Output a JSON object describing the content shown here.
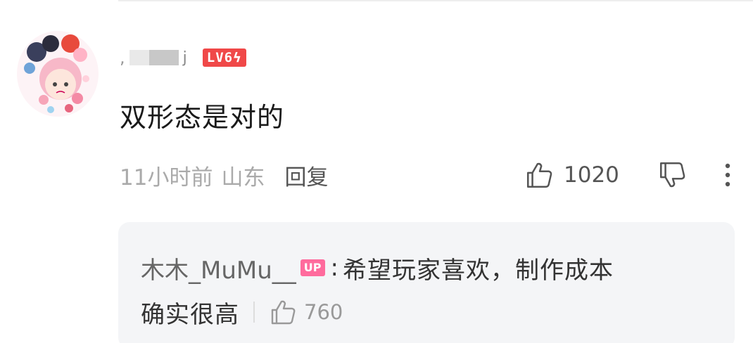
{
  "comment": {
    "username_prefix": ",",
    "username_suffix": "j",
    "level": "LV6",
    "level_icon": "lightning-icon",
    "text": "双形态是对的",
    "time": "11小时前",
    "location": "山东",
    "reply_label": "回复",
    "like_count": "1020"
  },
  "reply": {
    "author": "木木_MuMu__",
    "badge": "UP",
    "colon": ":",
    "content_line1": "希望玩家喜欢，制作成本",
    "content_line2": "确实很高",
    "like_count": "760"
  },
  "colors": {
    "level_badge": "#f04848",
    "up_badge": "#ff6b9d",
    "reply_bg": "#f4f5f7"
  }
}
